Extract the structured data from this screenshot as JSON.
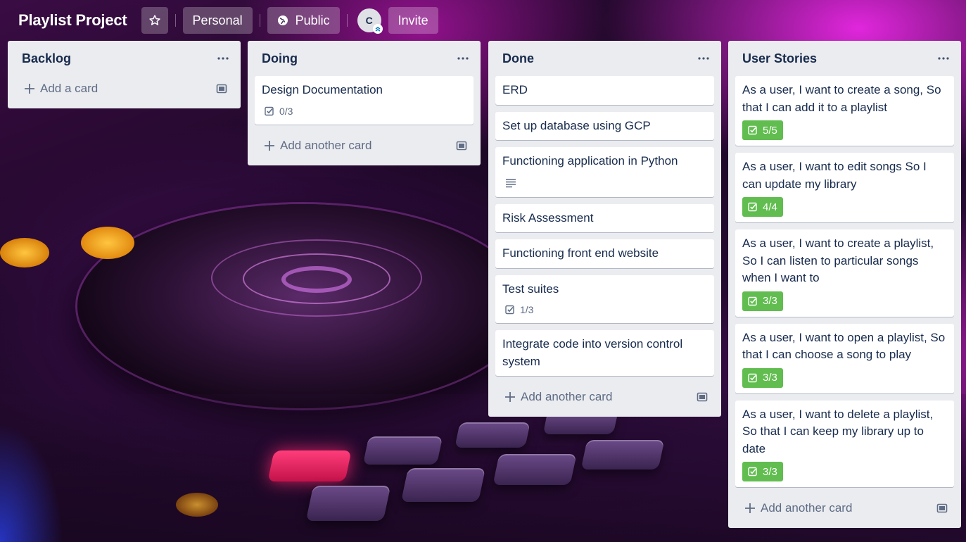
{
  "header": {
    "board_title": "Playlist Project",
    "workspace_label": "Personal",
    "visibility_label": "Public",
    "member_initial": "C",
    "invite_label": "Invite"
  },
  "colors": {
    "list_bg": "#ebecf0",
    "complete_badge": "#61bd4f",
    "text": "#172b4d",
    "muted": "#5e6c84"
  },
  "lists": [
    {
      "title": "Backlog",
      "add_label": "Add a card",
      "cards": []
    },
    {
      "title": "Doing",
      "add_label": "Add another card",
      "cards": [
        {
          "title": "Design Documentation",
          "checklist": "0/3",
          "complete": false
        }
      ]
    },
    {
      "title": "Done",
      "add_label": "Add another card",
      "cards": [
        {
          "title": "ERD"
        },
        {
          "title": "Set up database using GCP"
        },
        {
          "title": "Functioning application in Python",
          "has_description": true
        },
        {
          "title": "Risk Assessment"
        },
        {
          "title": "Functioning front end website"
        },
        {
          "title": "Test suites",
          "checklist": "1/3",
          "complete": false
        },
        {
          "title": "Integrate code into version control system"
        }
      ]
    },
    {
      "title": "User Stories",
      "add_label": "Add another card",
      "cards": [
        {
          "title": "As a user, I want to create a song, So that I can add it to a playlist",
          "checklist": "5/5",
          "complete": true
        },
        {
          "title": "As a user, I want to edit songs So I can update my library",
          "checklist": "4/4",
          "complete": true
        },
        {
          "title": "As a user, I want to create a playlist, So I can listen to particular songs when I want to",
          "checklist": "3/3",
          "complete": true
        },
        {
          "title": "As a user, I want to open a playlist, So that I can choose a song to play",
          "checklist": "3/3",
          "complete": true
        },
        {
          "title": "As a user, I want to delete a playlist, So that I can keep my library up to date",
          "checklist": "3/3",
          "complete": true
        }
      ]
    }
  ]
}
